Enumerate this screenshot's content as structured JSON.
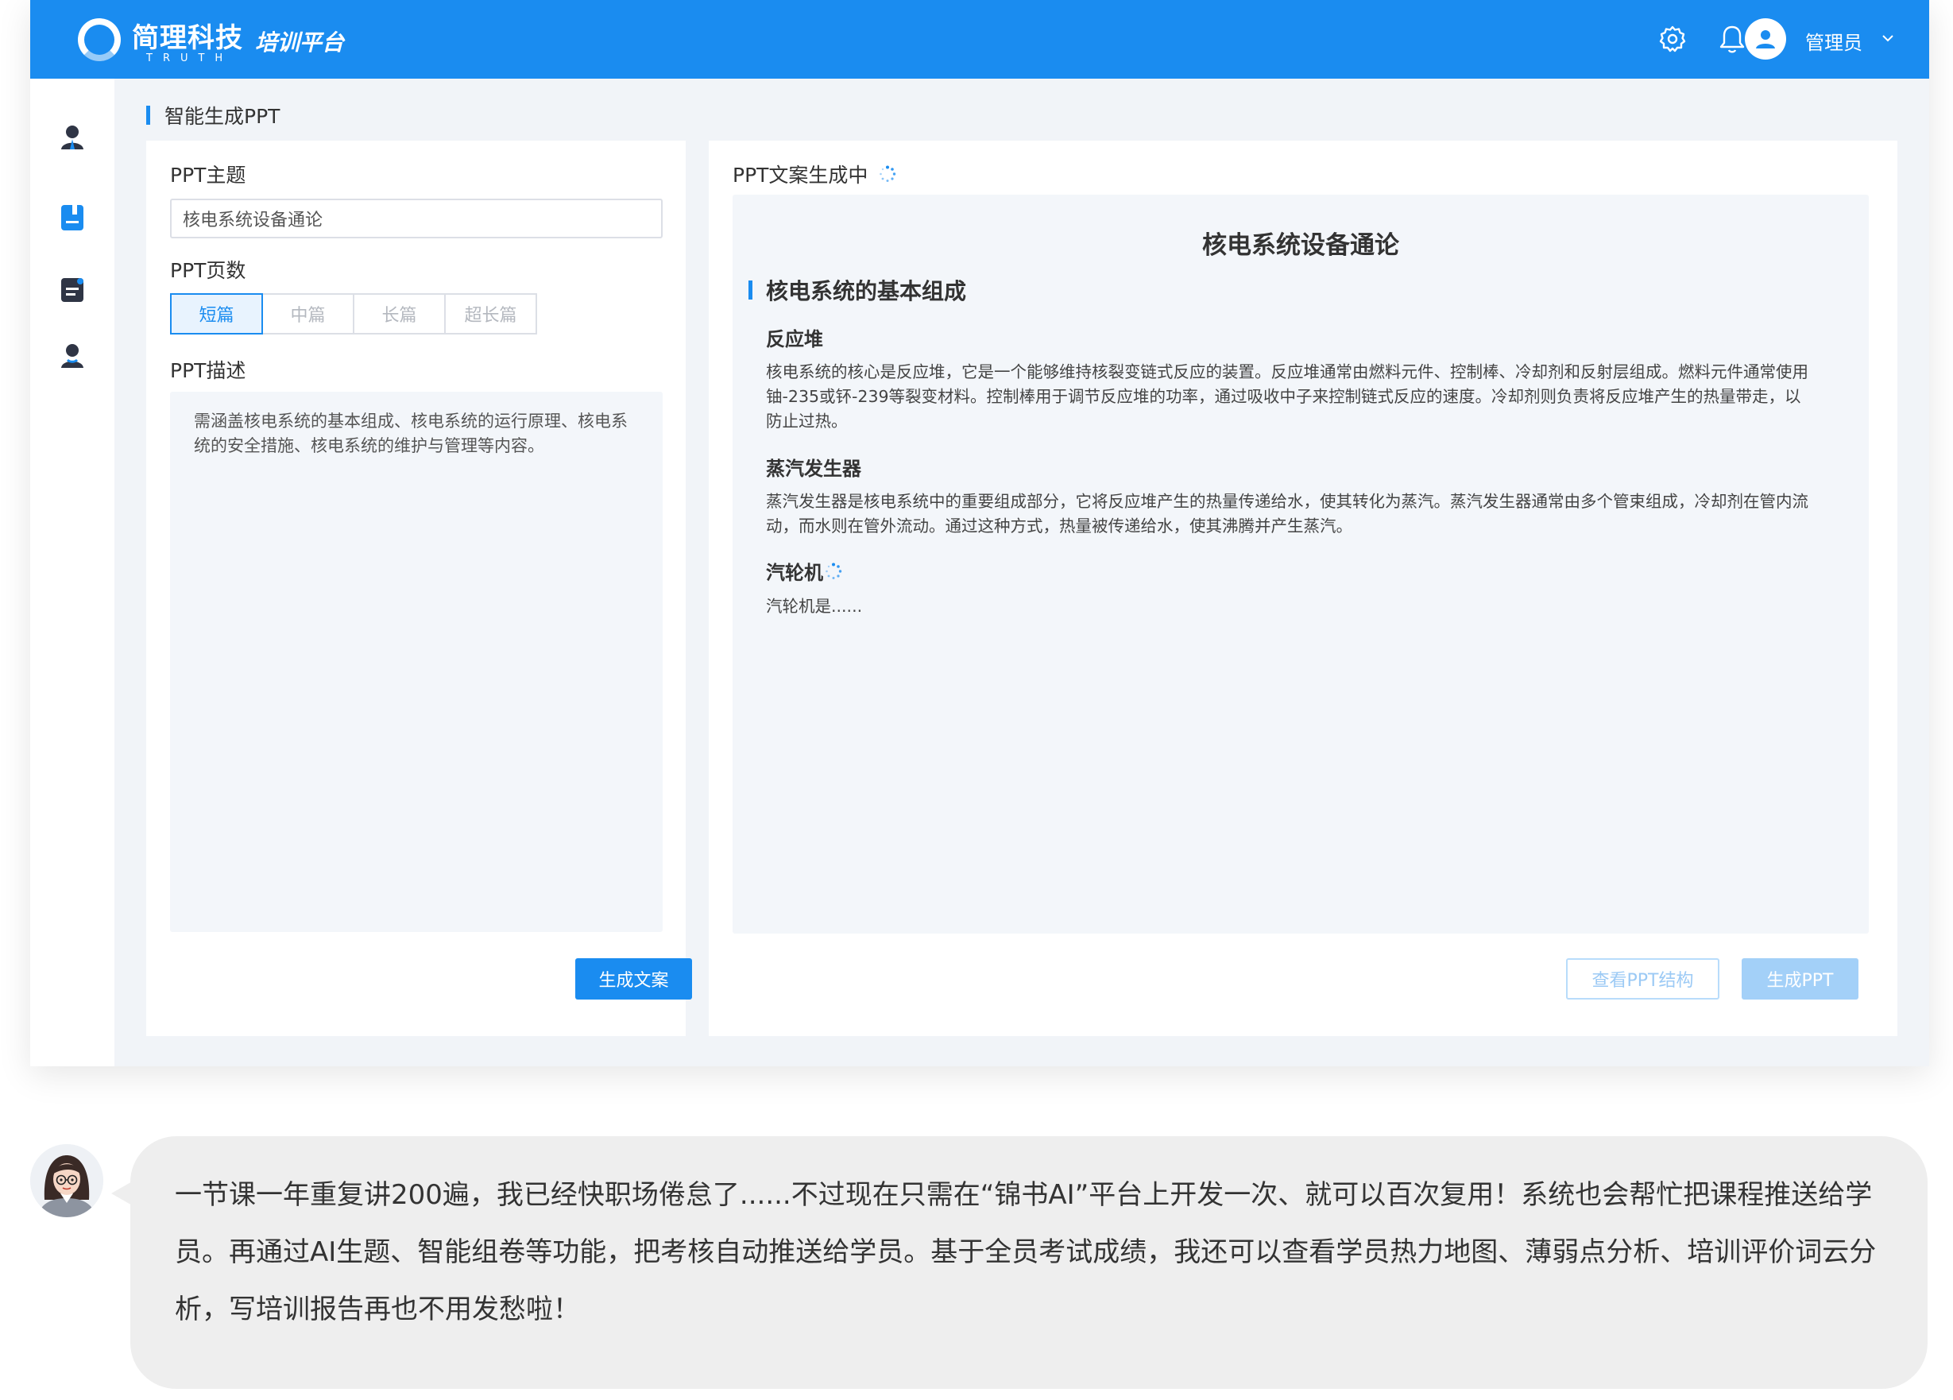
{
  "header": {
    "brand_name": "简理科技",
    "brand_sub": "TRUTH",
    "platform": "培训平台",
    "user_name": "管理员",
    "icons": [
      "gear-icon",
      "bell-icon",
      "avatar-icon",
      "chevron-down-icon"
    ]
  },
  "sidebar": {
    "items": [
      {
        "icon": "user-icon"
      },
      {
        "icon": "book-icon"
      },
      {
        "icon": "document-icon"
      },
      {
        "icon": "user-dark-icon"
      }
    ]
  },
  "page": {
    "title": "智能生成PPT"
  },
  "form": {
    "topic_label": "PPT主题",
    "topic_value": "核电系统设备通论",
    "pages_label": "PPT页数",
    "pages_options": [
      "短篇",
      "中篇",
      "长篇",
      "超长篇"
    ],
    "pages_selected": "短篇",
    "desc_label": "PPT描述",
    "desc_value": "需涵盖核电系统的基本组成、核电系统的运行原理、核电系统的安全措施、核电系统的维护与管理等内容。",
    "generate_button": "生成文案"
  },
  "result": {
    "status_label": "PPT文案生成中",
    "doc_title": "核电系统设备通论",
    "section_title": "核电系统的基本组成",
    "subsections": [
      {
        "title": "反应堆",
        "text": "核电系统的核心是反应堆，它是一个能够维持核裂变链式反应的装置。反应堆通常由燃料元件、控制棒、冷却剂和反射层组成。燃料元件通常使用铀-235或钚-239等裂变材料。控制棒用于调节反应堆的功率，通过吸收中子来控制链式反应的速度。冷却剂则负责将反应堆产生的热量带走，以防止过热。"
      },
      {
        "title": "蒸汽发生器",
        "text": "蒸汽发生器是核电系统中的重要组成部分，它将反应堆产生的热量传递给水，使其转化为蒸汽。蒸汽发生器通常由多个管束组成，冷却剂在管内流动，而水则在管外流动。通过这种方式，热量被传递给水，使其沸腾并产生蒸汽。"
      },
      {
        "title": "汽轮机",
        "text": "汽轮机是......"
      }
    ],
    "view_structure_button": "查看PPT结构",
    "generate_ppt_button": "生成PPT",
    "accent_color": "#1a8cf0"
  },
  "testimonial": {
    "text": "一节课一年重复讲200遍，我已经快职场倦怠了......不过现在只需在“锦书AI”平台上开发一次、就可以百次复用！系统也会帮忙把课程推送给学员。再通过AI生题、智能组卷等功能，把考核自动推送给学员。基于全员考试成绩，我还可以查看学员热力地图、薄弱点分析、培训评价词云分析，写培训报告再也不用发愁啦！"
  }
}
